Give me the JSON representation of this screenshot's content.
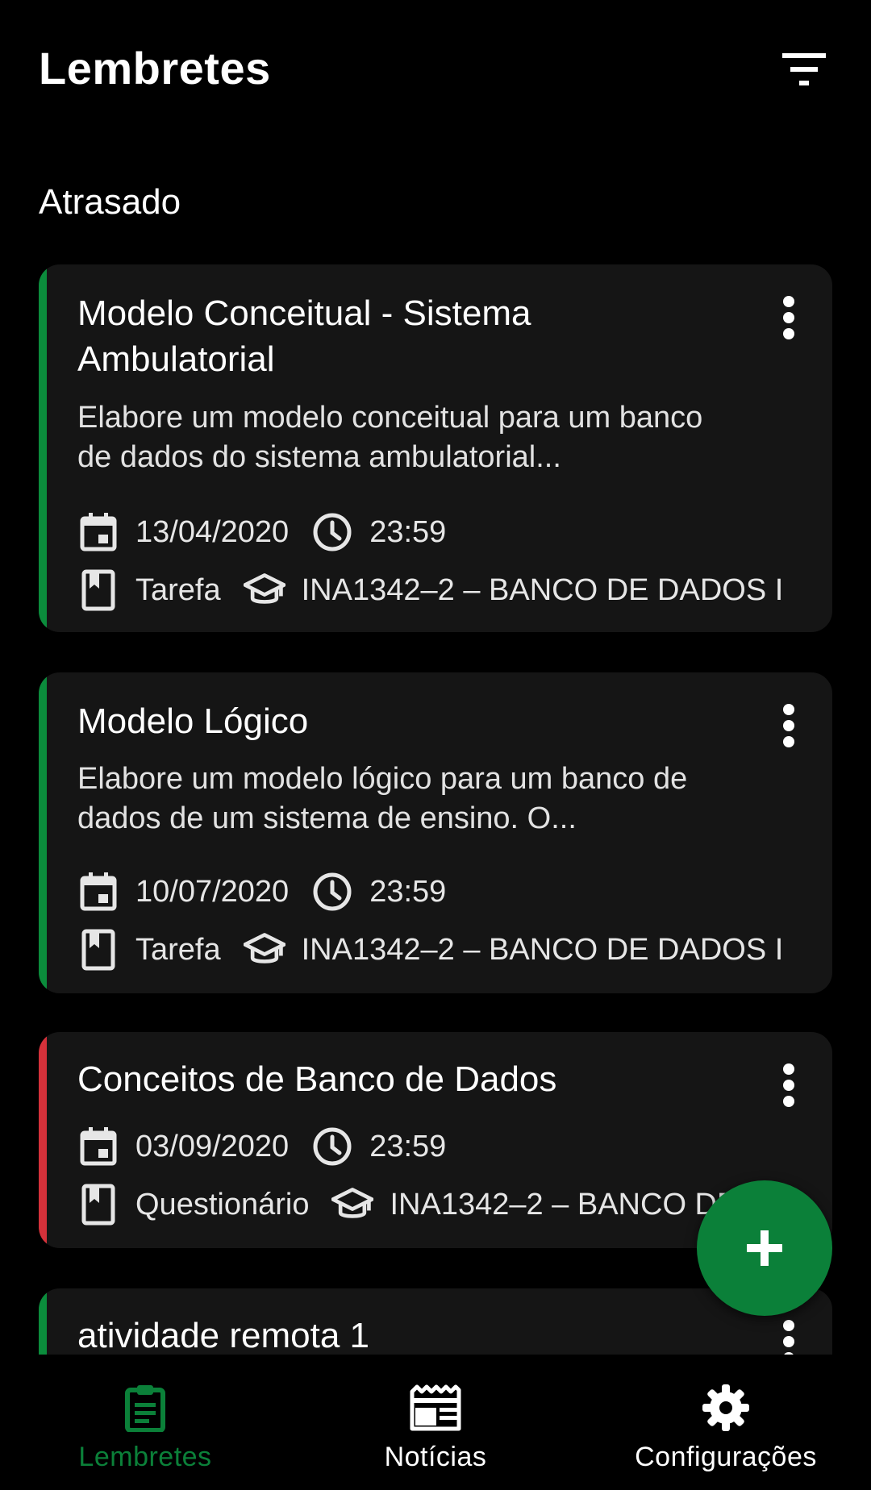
{
  "header": {
    "title": "Lembretes",
    "filter_icon": "filter-icon"
  },
  "section": {
    "label": "Atrasado"
  },
  "colors": {
    "accent_green": "#0b8039",
    "stripe_green": "#0b8c3c",
    "stripe_red": "#d4313a",
    "card_bg": "#151515"
  },
  "reminders": [
    {
      "title": "Modelo Conceitual - Sistema Ambulatorial",
      "description": "Elabore um modelo conceitual para um banco de dados do sistema ambulatorial...",
      "date": "13/04/2020",
      "time": "23:59",
      "type": "Tarefa",
      "course": "INA1342–2 – BANCO DE DADOS I",
      "status_color": "green"
    },
    {
      "title": "Modelo Lógico",
      "description": "Elabore um modelo lógico para um banco de dados de um sistema de ensino. O...",
      "date": "10/07/2020",
      "time": "23:59",
      "type": "Tarefa",
      "course": "INA1342–2 – BANCO DE DADOS I",
      "status_color": "green"
    },
    {
      "title": "Conceitos de Banco de Dados",
      "description": "",
      "date": "03/09/2020",
      "time": "23:59",
      "type": "Questionário",
      "course": "INA1342–2 – BANCO DE DADOS I",
      "status_color": "red"
    },
    {
      "title": "atividade remota 1",
      "status_color": "green"
    }
  ],
  "fab": {
    "icon": "plus-icon"
  },
  "bottom_nav": [
    {
      "label": "Lembretes",
      "icon": "clipboard-icon",
      "active": true
    },
    {
      "label": "Notícias",
      "icon": "newspaper-icon",
      "active": false
    },
    {
      "label": "Configurações",
      "icon": "gear-icon",
      "active": false
    }
  ]
}
